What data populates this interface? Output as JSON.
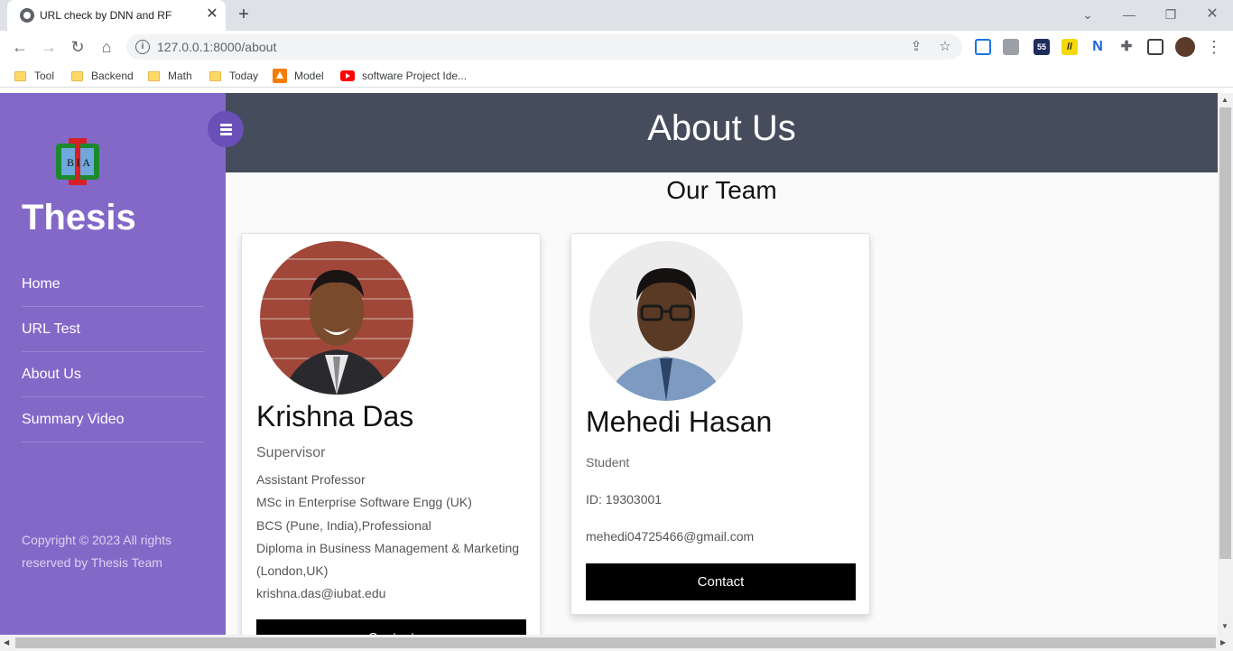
{
  "browser": {
    "tab_title": "URL check by DNN and RF",
    "tab_close": "✕",
    "new_tab": "+",
    "url": "127.0.0.1:8000/about",
    "bookmarks": [
      "Tool",
      "Backend",
      "Math",
      "Today",
      "Model",
      "software Project Ide..."
    ],
    "ext_badge": "55"
  },
  "sidebar": {
    "brand": "Thesis",
    "logo_text": "BIA",
    "nav": [
      "Home",
      "URL Test",
      "About Us",
      "Summary Video"
    ],
    "copyright": "Copyright © 2023 All rights reserved by Thesis Team"
  },
  "header": {
    "title": "About Us",
    "subtitle": "Our Team"
  },
  "team": [
    {
      "name": "Krishna Das",
      "role": "Supervisor",
      "details": [
        "Assistant Professor",
        "MSc in Enterprise Software Engg (UK)",
        "BCS (Pune, India),Professional",
        "Diploma in Business Management & Marketing",
        "(London,UK)",
        "krishna.das@iubat.edu"
      ],
      "contact": "Contact"
    },
    {
      "name": "Mehedi Hasan",
      "role": "Student",
      "details": [
        "ID: 19303001",
        "mehedi04725466@gmail.com"
      ],
      "contact": "Contact"
    }
  ],
  "colors": {
    "sidebar": "#8468c8",
    "header": "#454c5c",
    "toggle": "#6a4fb8"
  }
}
